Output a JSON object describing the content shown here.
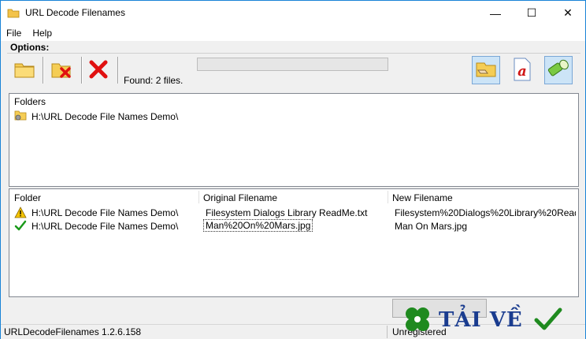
{
  "window": {
    "title": "URL Decode Filenames",
    "controls": {
      "minimize": "—",
      "maximize": "☐",
      "close": "✕"
    }
  },
  "menu": [
    {
      "label": "File"
    },
    {
      "label": "Help"
    }
  ],
  "options_label": "Options:",
  "toolbar": {
    "found_text": "Found: 2 files.",
    "progress_fraction": 0.0
  },
  "folders_panel": {
    "header": "Folders",
    "items": [
      {
        "path": "H:\\URL Decode File Names Demo\\"
      }
    ]
  },
  "files_panel": {
    "columns": [
      "Folder",
      "Original Filename",
      "New Filename"
    ],
    "rows": [
      {
        "status": "warning",
        "folder": "H:\\URL Decode File Names Demo\\",
        "original": "Filesystem Dialogs Library ReadMe.txt",
        "new": "Filesystem%20Dialogs%20Library%20Read..."
      },
      {
        "status": "ok",
        "folder": "H:\\URL Decode File Names Demo\\",
        "original": "Man%20On%20Mars.jpg",
        "new": "Man On Mars.jpg"
      }
    ]
  },
  "statusbar": {
    "version": "URLDecodeFilenames 1.2.6.158",
    "registration": "Unregistered"
  },
  "watermark": {
    "text": "TẢI VỀ"
  },
  "colors": {
    "accent": "#1883d7",
    "warning": "#f5c400",
    "ok": "#1a9a1a",
    "delete_red": "#e01010",
    "watermark_blue": "#1a3c8f",
    "watermark_green": "#1f8a1f"
  }
}
